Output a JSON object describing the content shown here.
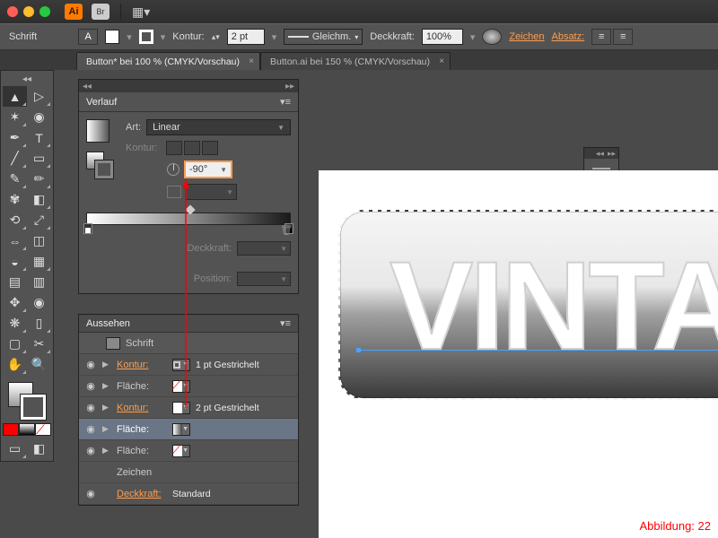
{
  "titlebar": {
    "app": "Ai",
    "bridge": "Br"
  },
  "controlbar": {
    "schrift": "Schrift",
    "kontur": "Kontur:",
    "stroke_w": "2 pt",
    "dash": "Gleichm.",
    "deck": "Deckkraft:",
    "deck_v": "100%",
    "zeichen": "Zeichen",
    "absatz": "Absatz:"
  },
  "tabs": {
    "t1": "Button* bei 100 % (CMYK/Vorschau)",
    "t2": "Button.ai bei 150 % (CMYK/Vorschau)"
  },
  "gradient_panel": {
    "title": "Verlauf",
    "art": "Art:",
    "type": "Linear",
    "kontur": "Kontur:",
    "angle": "-90°",
    "deck": "Deckkraft:",
    "pos": "Position:"
  },
  "appearance_panel": {
    "title": "Aussehen",
    "schrift": "Schrift",
    "r1_l": "Kontur:",
    "r1_v": "1 pt Gestrichelt",
    "r2_l": "Fläche:",
    "r3_l": "Kontur:",
    "r3_v": "2 pt Gestrichelt",
    "r4_l": "Fläche:",
    "r5_l": "Fläche:",
    "zeichen": "Zeichen",
    "r6_l": "Deckkraft:",
    "r6_v": "Standard"
  },
  "canvas": {
    "text": "VINTAG"
  },
  "figure": "Abbildung: 22"
}
